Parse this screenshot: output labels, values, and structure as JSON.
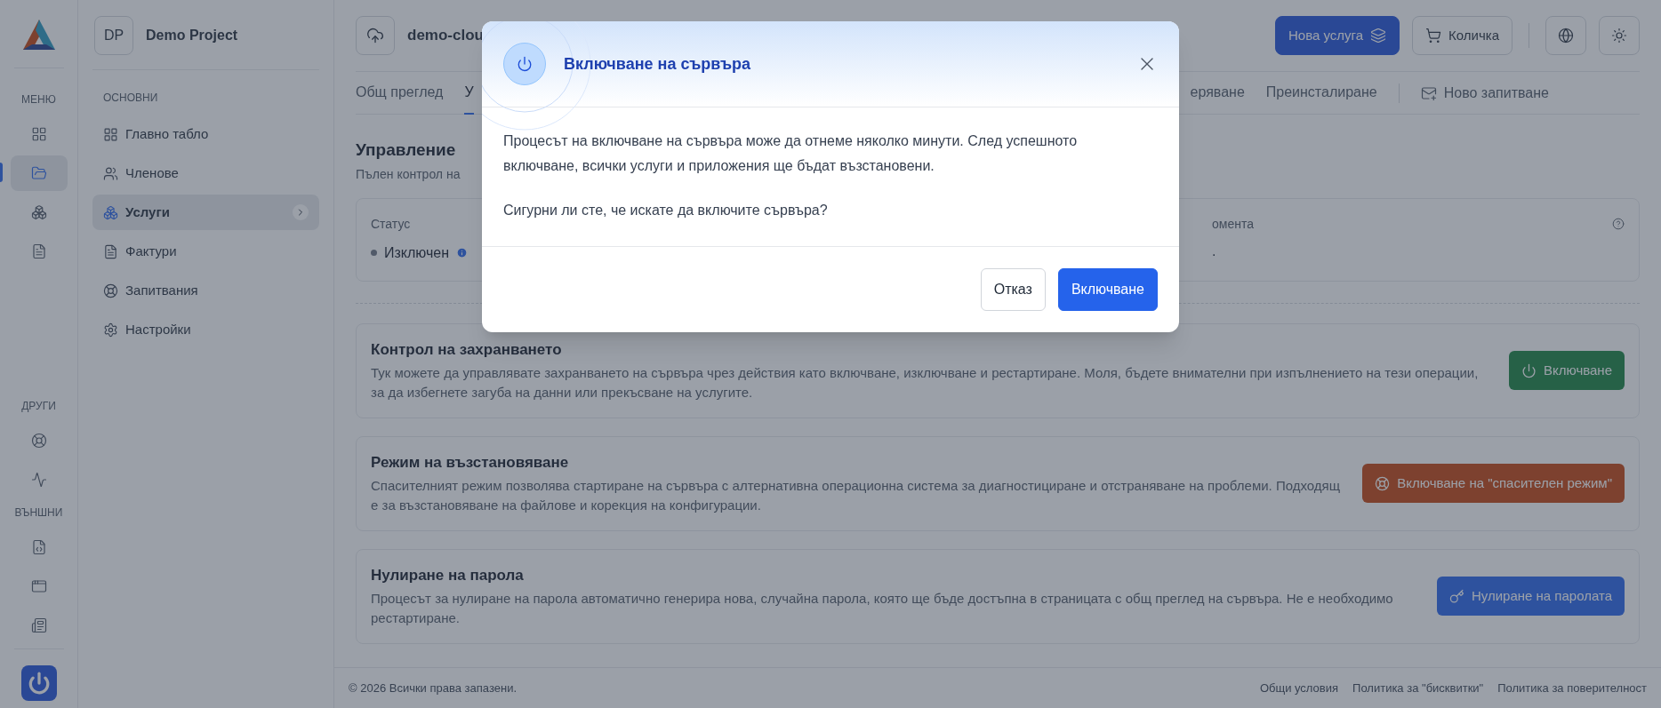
{
  "rail": {
    "sections": [
      {
        "label": "МЕНЮ",
        "items": [
          {
            "selected": false
          },
          {
            "selected": true
          },
          {
            "selected": false
          },
          {
            "selected": false
          }
        ]
      },
      {
        "label": "ДРУГИ",
        "items": [
          {
            "selected": false
          },
          {
            "selected": false
          }
        ]
      },
      {
        "label": "ВЪНШНИ",
        "items": [
          {
            "selected": false
          },
          {
            "selected": false
          },
          {
            "selected": false
          }
        ]
      }
    ]
  },
  "project": {
    "initials": "DP",
    "name": "Demo Project"
  },
  "sidebar": {
    "section": "ОСНОВНИ",
    "items": [
      {
        "label": "Главно табло",
        "selected": false
      },
      {
        "label": "Членове",
        "selected": false
      },
      {
        "label": "Услуги",
        "selected": true
      },
      {
        "label": "Фактури",
        "selected": false
      },
      {
        "label": "Запитвания",
        "selected": false
      },
      {
        "label": "Настройки",
        "selected": false
      }
    ]
  },
  "header": {
    "server_name": "demo-clou",
    "buttons": [
      {
        "label": "Нова услуга",
        "kind": "primary"
      },
      {
        "label": "Количка",
        "kind": "outline"
      }
    ]
  },
  "tabs": [
    {
      "label": "Общ преглед",
      "selected": false
    },
    {
      "label": "У",
      "selected": true
    },
    {
      "label": "еряване",
      "selected": false
    },
    {
      "label": "Преинсталиране",
      "selected": false
    }
  ],
  "new_request": "Ново запитване",
  "section": {
    "title": "Управление",
    "subtitle": "Пълен контрол на"
  },
  "status_card": {
    "label": "Статус",
    "value": "Изключен",
    "right_label": "омента",
    "right_value": "."
  },
  "actions": [
    {
      "kind": "power",
      "title": "Контрол на захранването",
      "description": "Тук можете да управлявате захранването на сървъра чрез действия като включване, изключване и рестартиране. Моля, бъдете внимателни при изпълнението на тези операции, за да избегнете загуба на данни или прекъсване на услугите.",
      "button": "Включване"
    },
    {
      "kind": "rescue",
      "title": "Режим на възстановяване",
      "description": "Спасителният режим позволява стартиране на сървъра с алтернативна операционна система за диагностициране и отстраняване на проблеми. Подходящ е за възстановяване на файлове и корекция на конфигурации.",
      "button": "Включване на \"спасителен режим\""
    },
    {
      "kind": "reset",
      "title": "Нулиране на парола",
      "description": "Процесът за нулиране на парола автоматично генерира нова, случайна парола, която ще бъде достъпна в страницата с общ преглед на сървъра. Не е необходимо рестартиране.",
      "button": "Нулиране на паролата"
    }
  ],
  "footer": {
    "copyright": "© 2026 Всички права запазени.",
    "links": [
      "Общи условия",
      "Политика за \"бисквитки\"",
      "Политика за поверителност"
    ]
  },
  "modal": {
    "title": "Включване на сървъра",
    "paragraphs": [
      "Процесът на включване на сървъра може да отнеме няколко минути. След успешното включване, всички услуги и приложения ще бъдат възстановени.",
      "Сигурни ли сте, че искате да включите сървъра?"
    ],
    "buttons": [
      {
        "label": "Отказ",
        "kind": "secondary"
      },
      {
        "label": "Включване",
        "kind": "primary"
      }
    ]
  }
}
